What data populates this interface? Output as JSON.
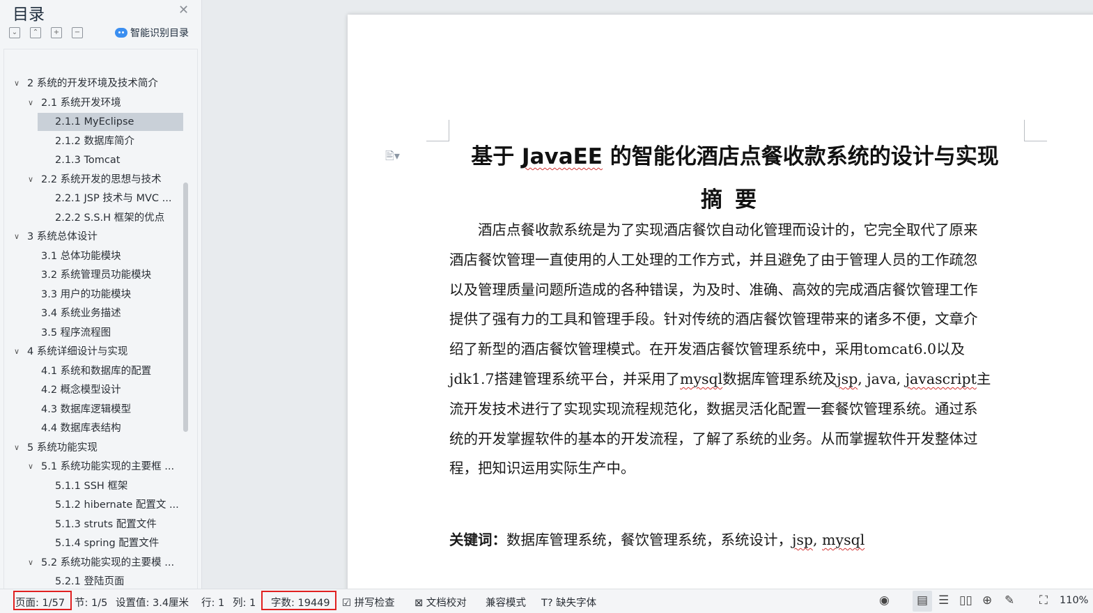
{
  "toc": {
    "title": "目录",
    "smart_label": "智能识别目录",
    "items": [
      {
        "label": "2 系统的开发环境及技术简介",
        "level": 1,
        "expanded": true
      },
      {
        "label": "2.1 系统开发环境",
        "level": 2,
        "expanded": true
      },
      {
        "label": "2.1.1 MyEclipse",
        "level": 3,
        "selected": true
      },
      {
        "label": "2.1.2 数据库简介",
        "level": 3
      },
      {
        "label": "2.1.3 Tomcat",
        "level": 3
      },
      {
        "label": "2.2 系统开发的思想与技术",
        "level": 2,
        "expanded": true
      },
      {
        "label": "2.2.1 JSP 技术与 MVC ...",
        "level": 3
      },
      {
        "label": "2.2.2 S.S.H 框架的优点",
        "level": 3
      },
      {
        "label": "3 系统总体设计",
        "level": 1,
        "expanded": true
      },
      {
        "label": "3.1 总体功能模块",
        "level": 2
      },
      {
        "label": "3.2 系统管理员功能模块",
        "level": 2
      },
      {
        "label": "3.3 用户的功能模块",
        "level": 2
      },
      {
        "label": "3.4 系统业务描述",
        "level": 2
      },
      {
        "label": "3.5 程序流程图",
        "level": 2
      },
      {
        "label": "4 系统详细设计与实现",
        "level": 1,
        "expanded": true
      },
      {
        "label": "4.1 系统和数据库的配置",
        "level": 2
      },
      {
        "label": "4.2 概念模型设计",
        "level": 2
      },
      {
        "label": "4.3 数据库逻辑模型",
        "level": 2
      },
      {
        "label": "4.4 数据库表结构",
        "level": 2
      },
      {
        "label": "5 系统功能实现",
        "level": 1,
        "expanded": true
      },
      {
        "label": "5.1 系统功能实现的主要框 ...",
        "level": 2,
        "expanded": true
      },
      {
        "label": "5.1.1 SSH 框架",
        "level": 3
      },
      {
        "label": "5.1.2 hibernate 配置文 ...",
        "level": 3
      },
      {
        "label": "5.1.3 struts 配置文件",
        "level": 3
      },
      {
        "label": "5.1.4 spring 配置文件",
        "level": 3
      },
      {
        "label": "5.2 系统功能实现的主要模 ...",
        "level": 2,
        "expanded": true
      },
      {
        "label": "5.2.1 登陆页面",
        "level": 3
      }
    ]
  },
  "document": {
    "title_pre": "基于 ",
    "title_sq": "JavaEE",
    "title_post": " 的智能化酒店点餐收款系统的设计与实现",
    "abstract_heading": "摘要",
    "lines": [
      [
        {
          "t": "　　酒店点餐收款系统是为了实现酒店餐饮自动化管理而设计的，它完全取代了原来"
        }
      ],
      [
        {
          "t": "酒店餐饮管理一直使用的人工处理的工作方式，并且避免了由于管理人员的工作疏忽"
        }
      ],
      [
        {
          "t": "以及管理质量问题所造成的各种错误，为及时、准确、高效的完成酒店餐饮管理工作"
        }
      ],
      [
        {
          "t": "提供了强有力的工具和管理手段。针对传统的酒店餐饮管理带来的诸多不便，文章介"
        }
      ],
      [
        {
          "t": "绍了新型的酒店餐饮管理模式。在开发酒店餐饮管理系统中，采用tomcat6.0以及"
        }
      ],
      [
        {
          "t": "jdk1.7搭建管理系统平台，并采用了"
        },
        {
          "t": "mysql",
          "sq": true
        },
        {
          "t": "数据库管理系统及"
        },
        {
          "t": "jsp",
          "sq": true
        },
        {
          "t": ", java, "
        },
        {
          "t": "javascript",
          "sq": true
        },
        {
          "t": "主"
        }
      ],
      [
        {
          "t": "流开发技术进行了实现实现流程规范化，数据灵活化配置一套餐饮管理系统。通过系"
        }
      ],
      [
        {
          "t": "统的开发掌握软件的基本的开发流程，了解了系统的业务。从而掌握软件开发整体过"
        }
      ],
      [
        {
          "t": "程，把知识运用实际生产中。"
        }
      ]
    ],
    "keywords_label": "关键词：",
    "keywords_pre": "数据库管理系统，餐饮管理系统，系统设计，",
    "keywords_sq1": "jsp",
    "keywords_sep": ", ",
    "keywords_sq2": "mysql"
  },
  "status": {
    "page": "页面: 1/57",
    "section": "节: 1/5",
    "setting": "设置值: 3.4厘米",
    "row": "行: 1",
    "col": "列: 1",
    "word_count": "字数: 19449",
    "spell_check": "拼写检查",
    "doc_proof": "文档校对",
    "compat_mode": "兼容模式",
    "missing_fonts": "缺失字体",
    "zoom": "110%"
  },
  "icons": [
    "close-icon",
    "expand-all-icon",
    "collapse-all-icon",
    "add-level-icon",
    "remove-level-icon",
    "ai-assistant-icon",
    "paragraph-icon",
    "eye-protection-icon",
    "page-view-icon",
    "outline-view-icon",
    "reading-view-icon",
    "web-view-icon",
    "write-view-icon",
    "fullscreen-icon"
  ],
  "colors": {
    "highlight_border": "#e02020",
    "spell_underline": "#d23030",
    "toc_selected": "#c9d0d8"
  }
}
